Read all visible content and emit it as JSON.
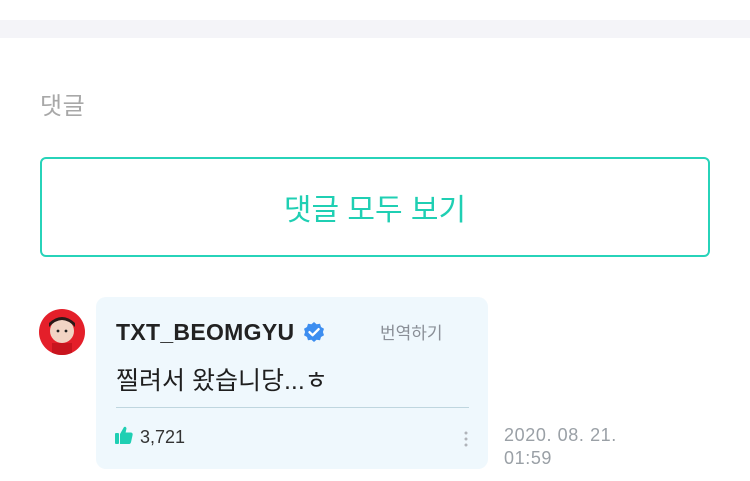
{
  "comments_section": {
    "title": "댓글",
    "view_all_label": "댓글 모두 보기"
  },
  "comment": {
    "author": "TXT_BEOMGYU",
    "verified": true,
    "translate_label": "번역하기",
    "text": "찔려서 왔습니당...ㅎ",
    "like_count": "3,721",
    "timestamp_date": "2020. 08. 21.",
    "timestamp_time": "01:59"
  },
  "colors": {
    "accent": "#27d3b9",
    "bubble_bg": "#eff8fd",
    "verified_badge": "#3d8ef0",
    "like_icon": "#1fcfb3"
  },
  "icons": {
    "verified": "verified-badge-icon",
    "like": "thumbs-up-icon",
    "more": "more-vertical-icon"
  }
}
